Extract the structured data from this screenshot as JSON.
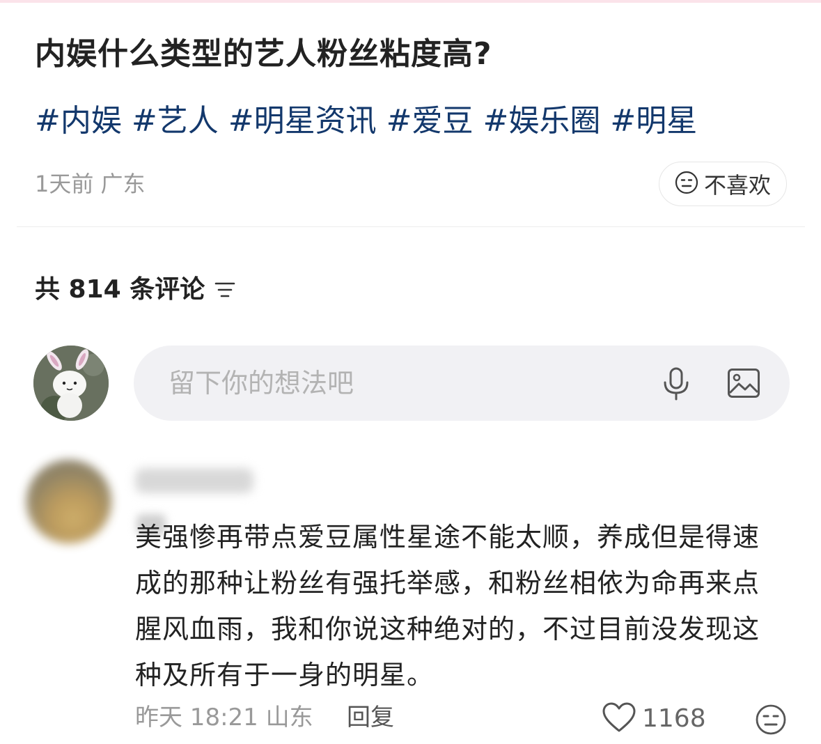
{
  "post": {
    "title": "内娱什么类型的艺人粉丝粘度高?",
    "tags": [
      "#内娱",
      "#艺人",
      "#明星资讯",
      "#爱豆",
      "#娱乐圈",
      "#明星"
    ],
    "time": "1天前",
    "location": "广东",
    "dislike_label": "不喜欢"
  },
  "comments_header": {
    "count_text": "共 814 条评论"
  },
  "input": {
    "placeholder": "留下你的想法吧"
  },
  "comment": {
    "text": "美强惨再带点爱豆属性星途不能太顺，养成但是得速成的那种让粉丝有强托举感，和粉丝相依为命再来点腥风血雨，我和你说这种绝对的，不过目前没发现这种及所有于一身的明星。",
    "meta": "昨天 18:21 山东",
    "reply_label": "回复",
    "likes": "1168"
  },
  "icons": {
    "dislike": "neutral-face-icon",
    "sort": "sort-icon",
    "mic": "microphone-icon",
    "image": "image-icon",
    "like": "heart-icon"
  },
  "colors": {
    "tag": "#13386c",
    "muted": "#999999",
    "input_bg": "#f1f1f4"
  }
}
